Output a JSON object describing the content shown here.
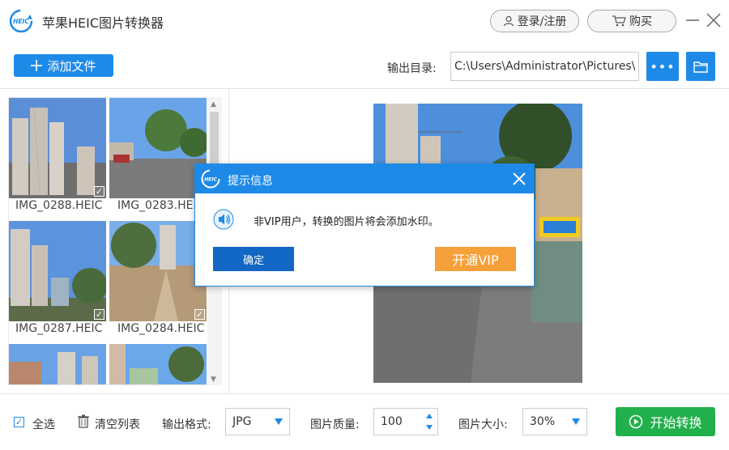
{
  "app": {
    "title": "苹果HEIC图片转换器",
    "logo_text": "HEIC"
  },
  "header": {
    "login_label": "登录/注册",
    "buy_label": "购买"
  },
  "toolbar": {
    "add_file_label": "添加文件",
    "output_dir_label": "输出目录:",
    "output_path": "C:\\Users\\Administrator\\Pictures\\",
    "more_label": "•••"
  },
  "files": [
    {
      "name": "IMG_0288.HEIC",
      "checked": true
    },
    {
      "name": "IMG_0283.HEIC",
      "checked": true
    },
    {
      "name": "IMG_0287.HEIC",
      "checked": true
    },
    {
      "name": "IMG_0284.HEIC",
      "checked": true
    },
    {
      "name": "",
      "checked": false
    },
    {
      "name": "",
      "checked": false
    }
  ],
  "bottom": {
    "select_all_label": "全选",
    "clear_list_label": "清空列表",
    "format_label": "输出格式:",
    "format_value": "JPG",
    "quality_label": "图片质量:",
    "quality_value": "100",
    "size_label": "图片大小:",
    "size_value": "30%",
    "start_label": "开始转换"
  },
  "dialog": {
    "title": "提示信息",
    "message": "非VIP用户，转换的图片将会添加水印。",
    "ok_label": "确定",
    "vip_label": "开通VIP"
  },
  "colors": {
    "accent": "#1e8ae8",
    "start": "#21b04b",
    "vip": "#f6a03a",
    "ok": "#1266c4"
  }
}
